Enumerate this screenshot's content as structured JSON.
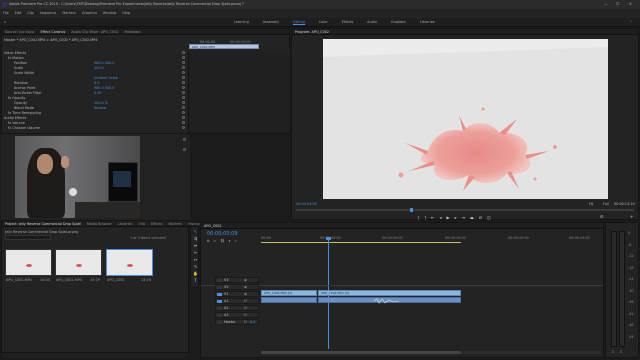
{
  "window": {
    "title": "Adobe Premiere Pro CC 2019 - C:\\Users\\TMT\\Desktop\\Premiere Pro Experiments\\Jelly Reverse\\Jelly Reverse Commercial Drop Splat.prproj *",
    "controls": [
      "—",
      "☐",
      "✕"
    ]
  },
  "menu": [
    "File",
    "Edit",
    "Clip",
    "Sequence",
    "Markers",
    "Graphics",
    "Window",
    "Help"
  ],
  "workspaces": [
    "Learning",
    "Assembly",
    "Editing",
    "Color",
    "Effects",
    "Audio",
    "Graphics",
    "Libraries"
  ],
  "workspace_active": "Editing",
  "effect_panel": {
    "tabs": [
      "Source: (no clips)",
      "Effect Controls",
      "Audio Clip Mixer: APO_C002",
      "Metadata"
    ],
    "active_tab": "Effect Controls",
    "header": "Master * APO_C002.MP4 > APO_C002 * APO_C002.MP4",
    "clip_tag": "APO_C002.MP4",
    "rows": [
      {
        "label": "Video Effects",
        "value": ""
      },
      {
        "label": "fx  Motion",
        "value": ""
      },
      {
        "label": "Position",
        "value": "960.0   540.0"
      },
      {
        "label": "Scale",
        "value": "100.0"
      },
      {
        "label": "Scale Width",
        "value": ""
      },
      {
        "label": "",
        "value": "Uniform Scale"
      },
      {
        "label": "Rotation",
        "value": "0.0"
      },
      {
        "label": "Anchor Point",
        "value": "960.0   540.0"
      },
      {
        "label": "Anti-flicker Filter",
        "value": "0.00"
      },
      {
        "label": "fx  Opacity",
        "value": ""
      },
      {
        "label": "Opacity",
        "value": "100.0 %"
      },
      {
        "label": "Blend Mode",
        "value": "Normal"
      },
      {
        "label": "fx  Time Remapping",
        "value": ""
      },
      {
        "label": "Audio Effects",
        "value": ""
      },
      {
        "label": "fx  Volume",
        "value": ""
      },
      {
        "label": "fx  Channel Volume",
        "value": ""
      }
    ],
    "timecodes": [
      "00:00:00",
      "00:00:15:00"
    ]
  },
  "program_monitor": {
    "tab": "Program: APO_C002",
    "timecode_current": "00:00:03:09",
    "timecode_total": "00:00:13:19",
    "fit": "Fit",
    "quality": "Full"
  },
  "project_panel": {
    "tabs": [
      "Project: Jelly Reverse Commercial Drop Splat",
      "Media Browser",
      "Libraries",
      "Info",
      "Effects",
      "Markers",
      "History"
    ],
    "path": "Jelly Reverse Commercial Drop Splat.prproj",
    "count": "1 of 3 items selected",
    "items": [
      {
        "name": "APO_C001.MP4",
        "duration": "10:03"
      },
      {
        "name": "APO_C002.MP4",
        "duration": "13:19"
      },
      {
        "name": "APO_C002",
        "duration": "13:19"
      }
    ]
  },
  "timeline": {
    "tab": "APO_C002",
    "timecode": "00:00:03:09",
    "ruler": [
      "00:00",
      "00:00:05:00",
      "00:00:10:00",
      "00:00:15:00",
      "00:00:20:00",
      "00:00:25:00"
    ],
    "tracks": [
      {
        "name": "V3"
      },
      {
        "name": "V2"
      },
      {
        "name": "V1"
      },
      {
        "name": "A1"
      },
      {
        "name": "A2"
      },
      {
        "name": "A3"
      },
      {
        "name": "Master"
      }
    ],
    "master_value": "0.0",
    "clips": [
      {
        "name": "APO_C002.MP4 [V]",
        "track": "V1"
      },
      {
        "name": "APO_C002.MP4 [V]",
        "track": "V1b"
      }
    ]
  },
  "audio_meter": {
    "labels": [
      "0",
      "-6",
      "-12",
      "-18",
      "-24",
      "-30",
      "-36",
      "-42",
      "-48",
      "-54"
    ],
    "footer": [
      "S",
      "S"
    ]
  }
}
